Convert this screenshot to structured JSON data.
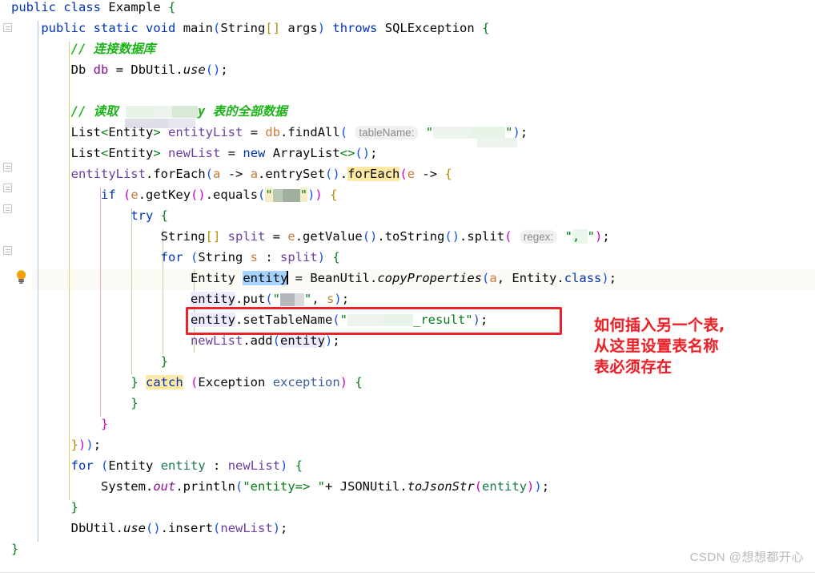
{
  "app": {
    "kind": "code-editor",
    "language": "Java",
    "background": "#ffffff"
  },
  "colors": {
    "keyword": "#0033b3",
    "string": "#067d17",
    "comment": "#1bb318",
    "field": "#871094",
    "annotation_red": "#e8232a",
    "current_line": "#fcfaf5",
    "selection": "#a6d2ff",
    "identifier_usage": "#eeeaff",
    "search_highlight": "#ffe9a6",
    "inlay_hint_bg": "#f0f0f0",
    "inlay_hint_fg": "#8c8c8c"
  },
  "gutter": {
    "lambda_markers": 5,
    "intention_icon": "lightbulb-icon",
    "intention_line": 13
  },
  "code": {
    "lines": [
      {
        "n": 1,
        "text": "public class Example {"
      },
      {
        "n": 2,
        "text": "    public static void main(String[] args) throws SQLException {"
      },
      {
        "n": 3,
        "text": "        // 连接数据库"
      },
      {
        "n": 4,
        "text": "        Db db = DbUtil.use();"
      },
      {
        "n": 5,
        "text": ""
      },
      {
        "n": 6,
        "text": "        // 读取 ███████ 表的全部数据"
      },
      {
        "n": 7,
        "text": "        List<Entity> entityList = db.findAll( tableName: \"█████\");"
      },
      {
        "n": 8,
        "text": "        List<Entity> newList = new ArrayList<>();"
      },
      {
        "n": 9,
        "text": "        entityList.forEach(a -> a.entrySet().forEach(e -> {"
      },
      {
        "n": 10,
        "text": "            if (e.getKey().equals(\"███\")) {"
      },
      {
        "n": 11,
        "text": "                try {"
      },
      {
        "n": 12,
        "text": "                    String[] split = e.getValue().toString().split( regex: \", \");"
      },
      {
        "n": 13,
        "text": "                    for (String s : split) {"
      },
      {
        "n": 14,
        "text": "                        Entity entity = BeanUtil.copyProperties(a, Entity.class);"
      },
      {
        "n": 15,
        "text": "                        entity.put(\"██\", s);"
      },
      {
        "n": 16,
        "text": "                        entity.setTableName(\"██████_result\");"
      },
      {
        "n": 17,
        "text": "                        newList.add(entity);"
      },
      {
        "n": 18,
        "text": "                    }"
      },
      {
        "n": 19,
        "text": "                } catch (Exception exception) {"
      },
      {
        "n": 20,
        "text": "                }"
      },
      {
        "n": 21,
        "text": "            }"
      },
      {
        "n": 22,
        "text": "        }));"
      },
      {
        "n": 23,
        "text": "        for (Entity entity : newList) {"
      },
      {
        "n": 24,
        "text": "            System.out.println(\"entity=> \"+ JSONUtil.toJsonStr(entity));"
      },
      {
        "n": 25,
        "text": "        }"
      },
      {
        "n": 26,
        "text": "        DbUtil.use().insert(newList);"
      },
      {
        "n": 27,
        "text": "    }"
      },
      {
        "n": 28,
        "text": "}"
      }
    ],
    "inlay_hints": [
      {
        "line": 7,
        "label": "tableName:"
      },
      {
        "line": 12,
        "label": "regex:"
      }
    ],
    "selected_text": "entity",
    "selection_line": 14,
    "highlighted_tokens": [
      "forEach",
      "catch"
    ],
    "current_line": 14,
    "comment_line3": "// 连接数据库",
    "comment_line6_prefix": "// 读取",
    "comment_line6_suffix": "表的全部数据"
  },
  "callout": {
    "box_label": "entity.setTableName(\"_result\");",
    "annotation_lines": [
      "如何插入另一个表,",
      "从这里设置表名称",
      "表必须存在"
    ]
  },
  "watermark": {
    "text": "CSDN @想想都开心"
  }
}
